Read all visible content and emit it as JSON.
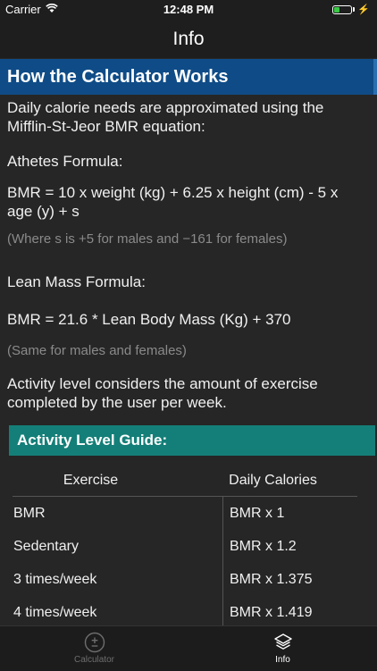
{
  "status": {
    "carrier": "Carrier",
    "time": "12:48 PM"
  },
  "nav": {
    "title": "Info"
  },
  "section": {
    "title": "How the Calculator Works"
  },
  "content": {
    "intro": "Daily calorie needs are approximated using the Mifflin-St-Jeor BMR equation:",
    "athletes_heading": "Athetes Formula:",
    "athletes_formula": "BMR = 10 x weight (kg) + 6.25 x height (cm) - 5 x age (y) + s",
    "athletes_note": "(Where s is +5 for males and −161 for females)",
    "lean_heading": "Lean Mass Formula:",
    "lean_formula": "BMR = 21.6 * Lean Body Mass (Kg) + 370",
    "lean_note": "(Same for males and females)",
    "activity_text": "Activity level considers the amount of exercise completed by the user per week."
  },
  "guide": {
    "title": "Activity Level Guide:",
    "columns": [
      "Exercise",
      "Daily Calories"
    ],
    "rows": [
      [
        "BMR",
        "BMR x 1"
      ],
      [
        "Sedentary",
        "BMR x 1.2"
      ],
      [
        "3 times/week",
        "BMR x 1.375"
      ],
      [
        "4 times/week",
        "BMR x 1.419"
      ]
    ]
  },
  "tabs": [
    {
      "label": "Calculator",
      "icon": "plus-minus-icon",
      "active": false
    },
    {
      "label": "Info",
      "icon": "layers-icon",
      "active": true
    }
  ],
  "colors": {
    "header_blue": "#0f4c87",
    "guide_teal": "#147f78",
    "background": "#262626",
    "battery_green": "#3ac845"
  }
}
